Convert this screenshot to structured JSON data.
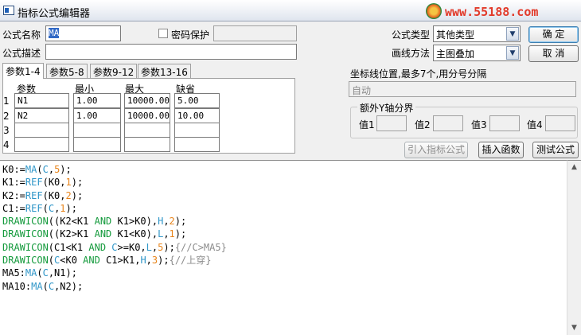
{
  "window": {
    "title": "指标公式编辑器"
  },
  "logo": {
    "text": "www.55188.com"
  },
  "form": {
    "name_label": "公式名称",
    "name_value": "MA",
    "password_label": "密码保护",
    "password_value": "",
    "desc_label": "公式描述",
    "desc_value": "",
    "type_label": "公式类型",
    "type_value": "其他类型",
    "draw_label": "画线方法",
    "draw_value": "主图叠加",
    "ok_label": "确  定",
    "cancel_label": "取  消"
  },
  "tabs": [
    {
      "label": "参数1-4",
      "active": true
    },
    {
      "label": "参数5-8",
      "active": false
    },
    {
      "label": "参数9-12",
      "active": false
    },
    {
      "label": "参数13-16",
      "active": false
    }
  ],
  "params": {
    "headers": [
      "参数",
      "最小",
      "最大",
      "缺省"
    ],
    "rows": [
      {
        "num": "1",
        "name": "N1",
        "min": "1.00",
        "max": "10000.00",
        "def": "5.00"
      },
      {
        "num": "2",
        "name": "N2",
        "min": "1.00",
        "max": "10000.00",
        "def": "10.00"
      },
      {
        "num": "3",
        "name": "",
        "min": "",
        "max": "",
        "def": ""
      },
      {
        "num": "4",
        "name": "",
        "min": "",
        "max": "",
        "def": ""
      }
    ]
  },
  "coord": {
    "label": "坐标线位置,最多7个,用分号分隔",
    "value": "自动"
  },
  "yaxis": {
    "title": "额外Y轴分界",
    "labels": [
      "值1",
      "值2",
      "值3",
      "值4"
    ],
    "values": [
      "",
      "",
      "",
      ""
    ]
  },
  "actions": {
    "import_label": "引入指标公式",
    "insert_label": "插入函数",
    "test_label": "测试公式"
  },
  "code": [
    [
      {
        "t": "K0:=",
        "c": "default"
      },
      {
        "t": "MA",
        "c": "func"
      },
      {
        "t": "(",
        "c": "default"
      },
      {
        "t": "C",
        "c": "func"
      },
      {
        "t": ",",
        "c": "default"
      },
      {
        "t": "5",
        "c": "num"
      },
      {
        "t": ");",
        "c": "default"
      }
    ],
    [
      {
        "t": "K1:=",
        "c": "default"
      },
      {
        "t": "REF",
        "c": "func"
      },
      {
        "t": "(K0,",
        "c": "default"
      },
      {
        "t": "1",
        "c": "num"
      },
      {
        "t": ");",
        "c": "default"
      }
    ],
    [
      {
        "t": "K2:=",
        "c": "default"
      },
      {
        "t": "REF",
        "c": "func"
      },
      {
        "t": "(K0,",
        "c": "default"
      },
      {
        "t": "2",
        "c": "num"
      },
      {
        "t": ");",
        "c": "default"
      }
    ],
    [
      {
        "t": "C1:=",
        "c": "default"
      },
      {
        "t": "REF",
        "c": "func"
      },
      {
        "t": "(",
        "c": "default"
      },
      {
        "t": "C",
        "c": "func"
      },
      {
        "t": ",",
        "c": "default"
      },
      {
        "t": "1",
        "c": "num"
      },
      {
        "t": ");",
        "c": "default"
      }
    ],
    [
      {
        "t": "DRAWICON",
        "c": "kw"
      },
      {
        "t": "((K2<K1 ",
        "c": "default"
      },
      {
        "t": "AND",
        "c": "kw"
      },
      {
        "t": " K1>K0),",
        "c": "default"
      },
      {
        "t": "H",
        "c": "func"
      },
      {
        "t": ",",
        "c": "default"
      },
      {
        "t": "2",
        "c": "num"
      },
      {
        "t": ");",
        "c": "default"
      }
    ],
    [
      {
        "t": "DRAWICON",
        "c": "kw"
      },
      {
        "t": "((K2>K1 ",
        "c": "default"
      },
      {
        "t": "AND",
        "c": "kw"
      },
      {
        "t": " K1<K0),",
        "c": "default"
      },
      {
        "t": "L",
        "c": "func"
      },
      {
        "t": ",",
        "c": "default"
      },
      {
        "t": "1",
        "c": "num"
      },
      {
        "t": ");",
        "c": "default"
      }
    ],
    [
      {
        "t": "DRAWICON",
        "c": "kw"
      },
      {
        "t": "(C1<K1 ",
        "c": "default"
      },
      {
        "t": "AND",
        "c": "kw"
      },
      {
        "t": " ",
        "c": "default"
      },
      {
        "t": "C",
        "c": "func"
      },
      {
        "t": ">=K0,",
        "c": "default"
      },
      {
        "t": "L",
        "c": "func"
      },
      {
        "t": ",",
        "c": "default"
      },
      {
        "t": "5",
        "c": "num"
      },
      {
        "t": ");",
        "c": "default"
      },
      {
        "t": "{//C>MA5}",
        "c": "comment"
      }
    ],
    [
      {
        "t": "DRAWICON",
        "c": "kw"
      },
      {
        "t": "(",
        "c": "default"
      },
      {
        "t": "C",
        "c": "func"
      },
      {
        "t": "<K0 ",
        "c": "default"
      },
      {
        "t": "AND",
        "c": "kw"
      },
      {
        "t": " C1>K1,",
        "c": "default"
      },
      {
        "t": "H",
        "c": "func"
      },
      {
        "t": ",",
        "c": "default"
      },
      {
        "t": "3",
        "c": "num"
      },
      {
        "t": ");",
        "c": "default"
      },
      {
        "t": "{//上穿}",
        "c": "comment"
      }
    ],
    [
      {
        "t": "MA5:",
        "c": "default"
      },
      {
        "t": "MA",
        "c": "func"
      },
      {
        "t": "(",
        "c": "default"
      },
      {
        "t": "C",
        "c": "func"
      },
      {
        "t": ",N1);",
        "c": "default"
      }
    ],
    [
      {
        "t": "MA10:",
        "c": "default"
      },
      {
        "t": "MA",
        "c": "func"
      },
      {
        "t": "(",
        "c": "default"
      },
      {
        "t": "C",
        "c": "func"
      },
      {
        "t": ",N2);",
        "c": "default"
      }
    ]
  ]
}
